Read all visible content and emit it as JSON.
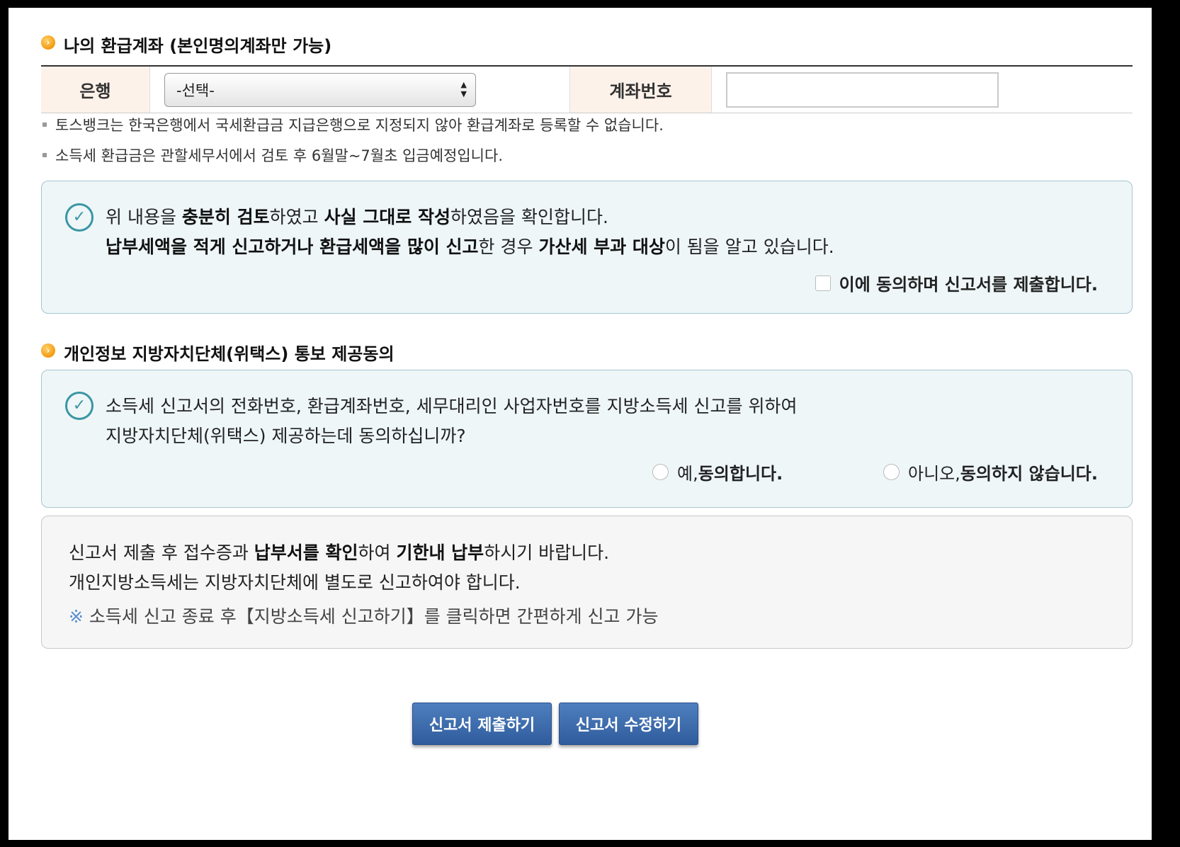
{
  "refund_account": {
    "section_title": "나의 환급계좌 (본인명의계좌만 가능)",
    "bank_label": "은행",
    "bank_select_value": "-선택-",
    "account_number_label": "계좌번호",
    "account_number_value": "",
    "notes": [
      "토스뱅크는 한국은행에서 국세환급금 지급은행으로 지정되지 않아 환급계좌로 등록할 수 없습니다.",
      "소득세 환급금은 관할세무서에서 검토 후 6월말~7월초 입금예정입니다."
    ]
  },
  "confirm_box": {
    "line1": {
      "p1": "위 내용을 ",
      "b1": "충분히 검토",
      "p2": "하였고 ",
      "b2": "사실 그대로 작성",
      "p3": "하였음을 확인합니다."
    },
    "line2": {
      "b1": "납부세액을 적게 신고하거나 환급세액을 많이 신고",
      "p1": "한 경우 ",
      "b2": "가산세 부과 대상",
      "p2": "이 됨을 알고 있습니다."
    },
    "agree_checkbox_label": "이에 동의하며 신고서를 제출합니다.",
    "agree_checked": false
  },
  "privacy_consent": {
    "section_title": "개인정보 지방자치단체(위택스) 통보 제공동의",
    "line1": "소득세 신고서의 전화번호, 환급계좌번호, 세무대리인 사업자번호를 지방소득세 신고를 위하여",
    "line2": "지방자치단체(위택스) 제공하는데 동의하십니까?",
    "yes_prefix": "예, ",
    "yes_label": "동의합니다.",
    "no_prefix": "아니오, ",
    "no_label": "동의하지 않습니다."
  },
  "notice": {
    "line1": {
      "p1": "신고서 제출 후 접수증과 ",
      "b1": "납부서를 확인",
      "p2": "하여 ",
      "b2": "기한내 납부",
      "p3": "하시기 바랍니다."
    },
    "line2": "개인지방소득세는 지방자치단체에 별도로 신고하여야 합니다.",
    "mark": "※",
    "line3": "소득세 신고 종료 후【지방소득세 신고하기】를 클릭하면 간편하게 신고 가능"
  },
  "buttons": {
    "submit": "신고서 제출하기",
    "edit": "신고서 수정하기"
  },
  "colors": {
    "header_cell_bg": "#fdf2ea",
    "confirm_box_bg": "#eef6f8",
    "check_icon": "#3a96a3",
    "button_blue": "#3a68a8",
    "bullet_orange": "#f39a12"
  }
}
